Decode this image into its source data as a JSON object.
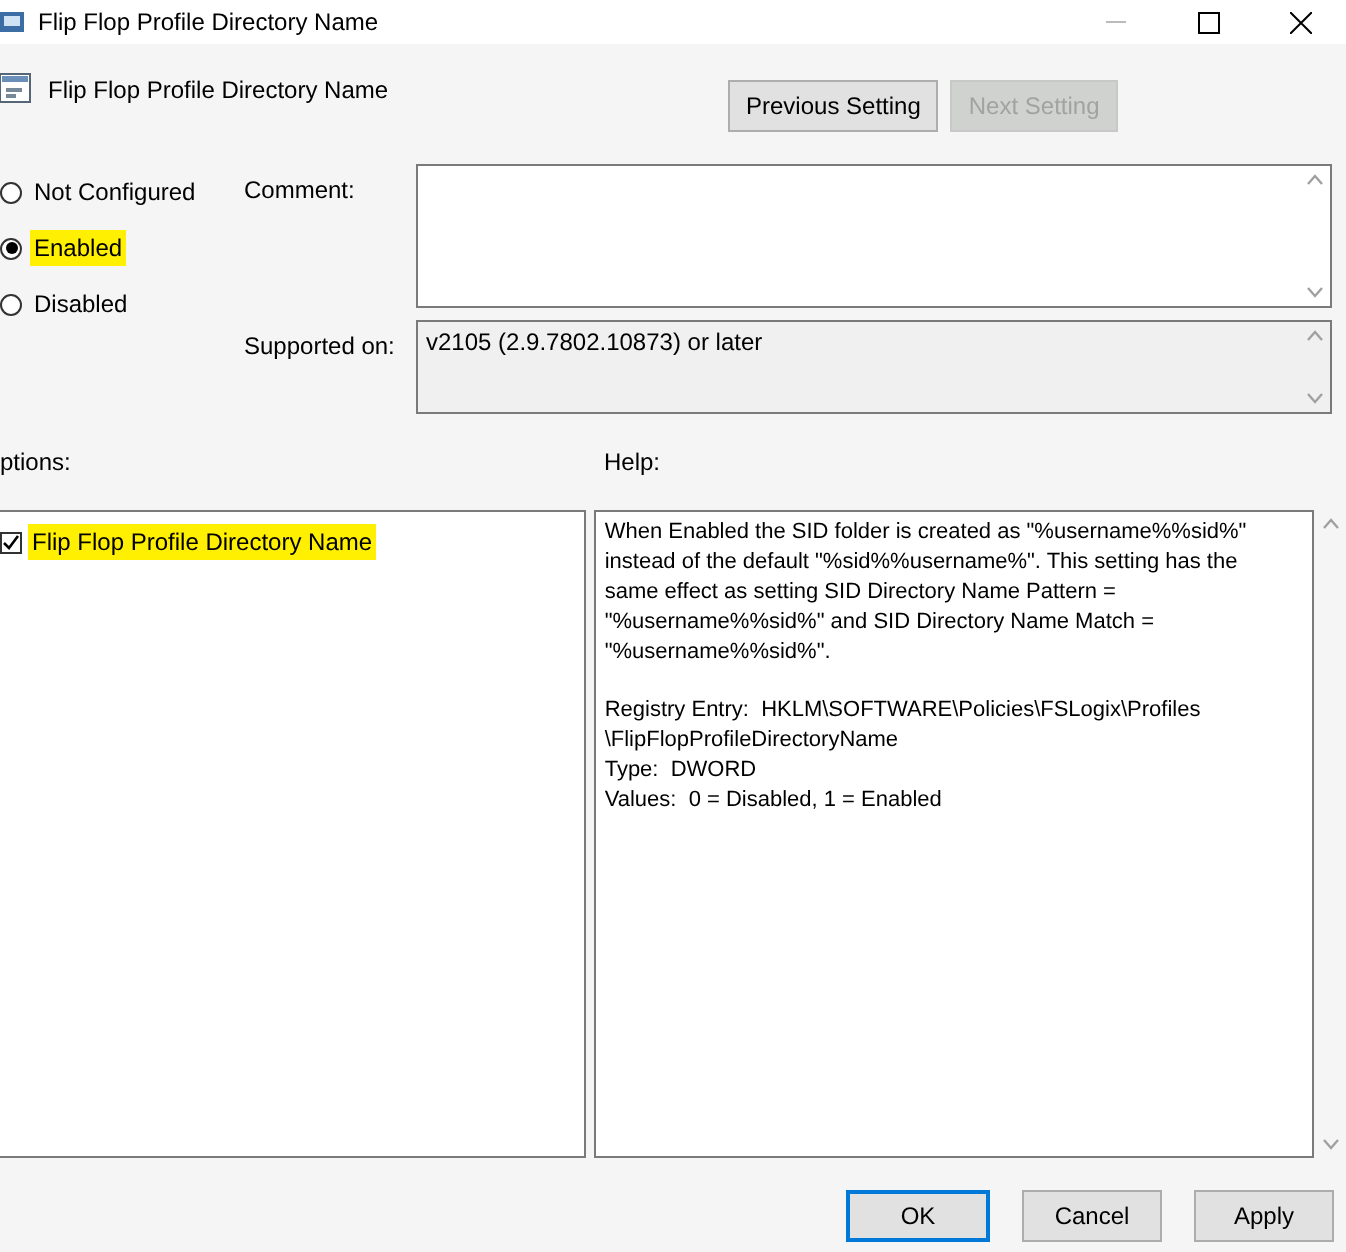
{
  "window": {
    "title": "Flip Flop Profile Directory Name"
  },
  "header": {
    "title": "Flip Flop Profile Directory Name"
  },
  "nav_buttons": [
    {
      "label": "Previous Setting",
      "disabled": false
    },
    {
      "label": "Next Setting",
      "disabled": true
    }
  ],
  "state_options": [
    {
      "label": "Not Configured",
      "selected": false,
      "highlighted": false
    },
    {
      "label": "Enabled",
      "selected": true,
      "highlighted": true
    },
    {
      "label": "Disabled",
      "selected": false,
      "highlighted": false
    }
  ],
  "comment": {
    "label": "Comment:"
  },
  "supported_on": {
    "label": "Supported on:",
    "value": "v2105 (2.9.7802.10873) or later"
  },
  "options": {
    "label": "ptions:",
    "items": [
      {
        "label": "Flip Flop Profile Directory Name",
        "checked": true,
        "highlighted": true
      }
    ]
  },
  "help": {
    "label": "Help:",
    "paragraphs": [
      "When Enabled the SID folder is created as \"%username%%sid%\"\ninstead of the default \"%sid%%username%\". This setting has the\nsame effect as setting SID Directory Name Pattern =\n\"%username%%sid%\" and SID Directory Name Match =\n\"%username%%sid%\".",
      "Registry Entry:  HKLM\\SOFTWARE\\Policies\\FSLogix\\Profiles\n\\FlipFlopProfileDirectoryName\nType:  DWORD\nValues:  0 = Disabled, 1 = Enabled"
    ]
  },
  "footer_buttons": [
    {
      "label": "OK",
      "default": true
    },
    {
      "label": "Cancel",
      "default": false
    },
    {
      "label": "Apply",
      "default": false
    }
  ]
}
